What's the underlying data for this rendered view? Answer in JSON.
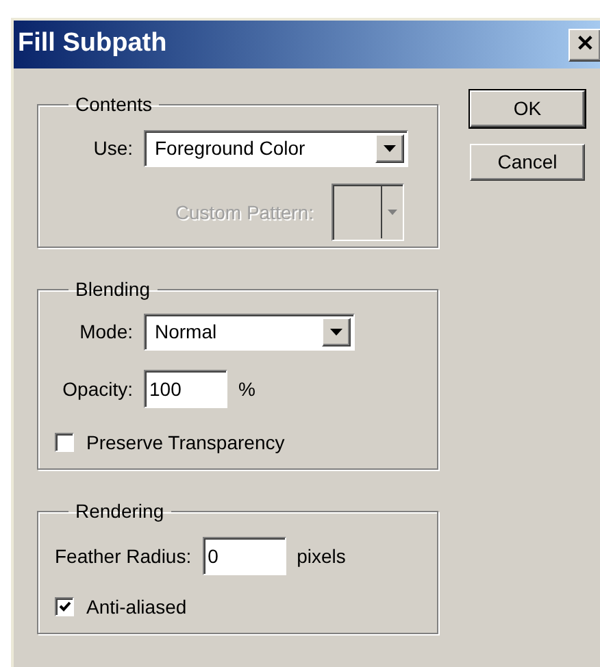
{
  "window": {
    "title": "Fill Subpath",
    "close": "✕"
  },
  "groups": [
    {
      "title": "Contents",
      "rows": [
        {
          "kind": "select",
          "label": "Use:",
          "value": "Foreground Color",
          "disabled": false
        },
        {
          "kind": "swatch",
          "label": "Custom Pattern:",
          "disabled": true
        }
      ]
    },
    {
      "title": "Blending",
      "rows": [
        {
          "kind": "select",
          "label": "Mode:",
          "value": "Normal",
          "disabled": false
        },
        {
          "kind": "input",
          "label": "Opacity:",
          "value": "100",
          "unit": "%"
        },
        {
          "kind": "checkbox",
          "label": "Preserve Transparency",
          "checked": false
        }
      ]
    },
    {
      "title": "Rendering",
      "rows": [
        {
          "kind": "input",
          "label": "Feather Radius:",
          "value": "0",
          "unit": "pixels"
        },
        {
          "kind": "checkbox",
          "label": "Anti-aliased",
          "checked": true
        }
      ]
    }
  ],
  "buttons": [
    {
      "label": "OK",
      "default": true
    },
    {
      "label": "Cancel",
      "default": false
    }
  ]
}
